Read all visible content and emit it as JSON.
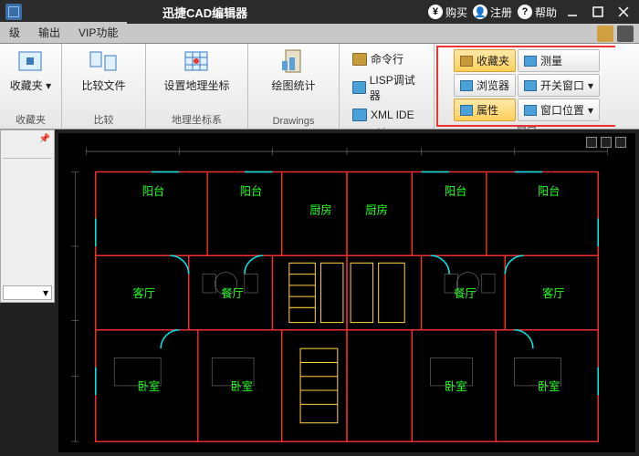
{
  "title": "迅捷CAD编辑器",
  "toolbar_top": {
    "buy": "购买",
    "register": "注册",
    "help": "帮助"
  },
  "tabs": {
    "t1": "级",
    "t2": "输出",
    "t3": "VIP功能"
  },
  "ribbon": {
    "g1": {
      "label": "收藏夹",
      "arrow": "▾",
      "cap": "收藏夹"
    },
    "g2": {
      "label": "比较文件",
      "cap": "比较"
    },
    "g3": {
      "label": "设置地理坐标",
      "cap": "地理坐标系"
    },
    "g4": {
      "label": "绘图统计",
      "cap": "Drawings"
    },
    "g5": {
      "i1": "命令行",
      "i2": "LISP调试器",
      "i3": "XML IDE",
      "cap": "Lisp"
    },
    "g6": {
      "b1": "收藏夹",
      "b2": "测量",
      "b3": "浏览器",
      "b4": "开关窗口",
      "b5": "属性",
      "b6": "窗口位置",
      "cap": "窗口"
    }
  },
  "sidepanel": {
    "pin": "📌",
    "sel": ""
  }
}
